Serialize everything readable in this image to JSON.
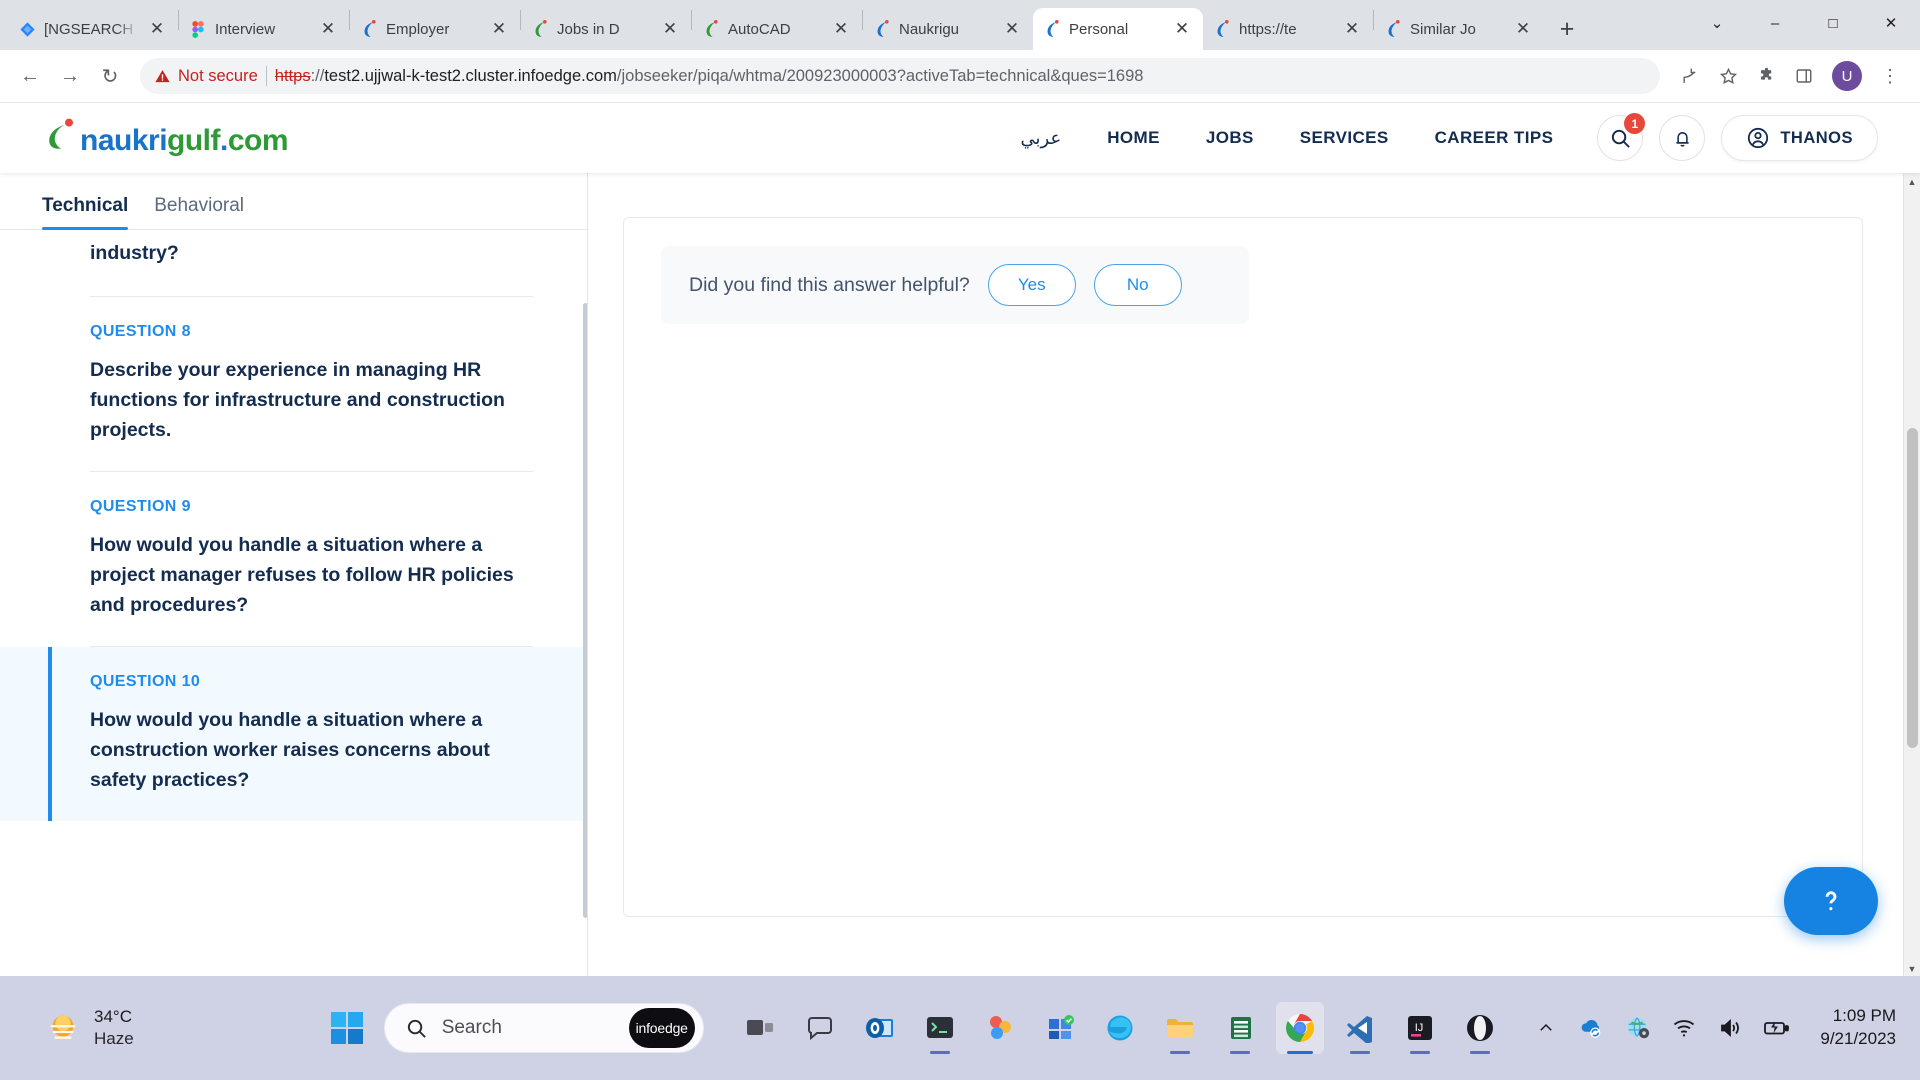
{
  "browser": {
    "tabs": [
      {
        "title": "[NGSEARCH",
        "favicon": "jira-icon",
        "active": false
      },
      {
        "title": "Interview",
        "favicon": "figma-icon",
        "active": false
      },
      {
        "title": "Employer",
        "favicon": "naukrigulf-blue-icon",
        "active": false
      },
      {
        "title": "Jobs in D",
        "favicon": "naukri-green-icon",
        "active": false
      },
      {
        "title": "AutoCAD",
        "favicon": "naukri-green-icon",
        "active": false
      },
      {
        "title": "Naukrigu",
        "favicon": "naukrigulf-blue-icon",
        "active": false
      },
      {
        "title": "Personal",
        "favicon": "naukrigulf-blue-icon",
        "active": true
      },
      {
        "title": "https://te",
        "favicon": "naukrigulf-blue-icon",
        "active": false
      },
      {
        "title": "Similar Jo",
        "favicon": "naukrigulf-blue-icon",
        "active": false
      }
    ],
    "new_tab_label": "+",
    "window_controls": {
      "minimize": "–",
      "maximize": "□",
      "close": "✕",
      "tab_search": "⌄"
    },
    "nav": {
      "back": "←",
      "forward": "→",
      "reload": "↻"
    },
    "omnibox": {
      "security_label": "Not secure",
      "scheme": "https",
      "scheme_separator": "://",
      "host": "test2.ujjwal-k-test2.cluster.infoedge.com",
      "path": "/jobseeker/piqa/whtma/200923000003?activeTab=technical&ques=1698",
      "full_url": "https://test2.ujjwal-k-test2.cluster.infoedge.com/jobseeker/piqa/whtma/200923000003?activeTab=technical&ques=1698"
    },
    "toolbar_icons": [
      "share-icon",
      "bookmark-star-icon",
      "extensions-puzzle-icon",
      "side-panel-icon"
    ],
    "profile_initial": "U",
    "menu_icon": "⋮"
  },
  "site": {
    "logo": {
      "naukri": "naukri",
      "gulf": "gulf",
      "dot": ".",
      "com": "com"
    },
    "nav": [
      {
        "label": "عربي",
        "name": "arabic"
      },
      {
        "label": "HOME",
        "name": "home"
      },
      {
        "label": "JOBS",
        "name": "jobs"
      },
      {
        "label": "SERVICES",
        "name": "services"
      },
      {
        "label": "CAREER TIPS",
        "name": "career-tips"
      }
    ],
    "search_badge": "1",
    "user_name": "THANOS"
  },
  "question_panel": {
    "tabs": [
      {
        "label": "Technical",
        "active": true
      },
      {
        "label": "Behavioral",
        "active": false
      }
    ],
    "clipped_question_tail": "industry?",
    "questions": [
      {
        "label": "QUESTION 8",
        "text": "Describe your experience in managing HR functions for infrastructure and construction projects.",
        "selected": false
      },
      {
        "label": "QUESTION 9",
        "text": "How would you handle a situation where a project manager refuses to follow HR policies and procedures?",
        "selected": false
      },
      {
        "label": "QUESTION 10",
        "text": "How would you handle a situation where a construction worker raises concerns about safety practices?",
        "selected": true
      }
    ]
  },
  "answer_panel": {
    "helpful_prompt": "Did you find this answer helpful?",
    "yes_label": "Yes",
    "no_label": "No",
    "chat_icon": "question-chat-icon"
  },
  "taskbar": {
    "weather": {
      "temp": "34°C",
      "condition": "Haze",
      "icon": "haze-sun-icon"
    },
    "search_placeholder": "Search",
    "search_chip": "infoedge",
    "apps": [
      {
        "name": "taskview",
        "icon": "task-view-icon",
        "running": false,
        "active": false
      },
      {
        "name": "teams-chat",
        "icon": "chat-bubble-icon",
        "running": false,
        "active": false
      },
      {
        "name": "outlook",
        "icon": "outlook-icon",
        "running": false,
        "active": false
      },
      {
        "name": "terminal",
        "icon": "terminal-icon",
        "running": true,
        "active": false
      },
      {
        "name": "paint",
        "icon": "paint-icon",
        "running": false,
        "active": false
      },
      {
        "name": "store",
        "icon": "store-icon",
        "running": false,
        "active": false
      },
      {
        "name": "edge",
        "icon": "edge-icon",
        "running": false,
        "active": false
      },
      {
        "name": "file-explorer",
        "icon": "folder-icon",
        "running": true,
        "active": false
      },
      {
        "name": "excel",
        "icon": "excel-icon",
        "running": true,
        "active": false
      },
      {
        "name": "chrome",
        "icon": "chrome-icon",
        "running": true,
        "active": true
      },
      {
        "name": "vscode",
        "icon": "vscode-icon",
        "running": true,
        "active": false
      },
      {
        "name": "intellij",
        "icon": "intellij-icon",
        "running": true,
        "active": false
      },
      {
        "name": "opera",
        "icon": "opera-icon",
        "running": true,
        "active": false
      }
    ],
    "tray": {
      "overflow": "chevron-up-icon",
      "icons": [
        "onedrive-sync-icon",
        "network-globe-icon",
        "wifi-icon",
        "volume-icon",
        "battery-charging-icon"
      ]
    },
    "clock": {
      "time": "1:09 PM",
      "date": "9/21/2023"
    }
  },
  "colors": {
    "accent_blue": "#1f8ceb",
    "brand_green": "#2e9a37",
    "brand_blue": "#1a73c7",
    "navy_text": "#132c4f",
    "warning_red": "#c5221f",
    "badge_red": "#e8483c"
  }
}
